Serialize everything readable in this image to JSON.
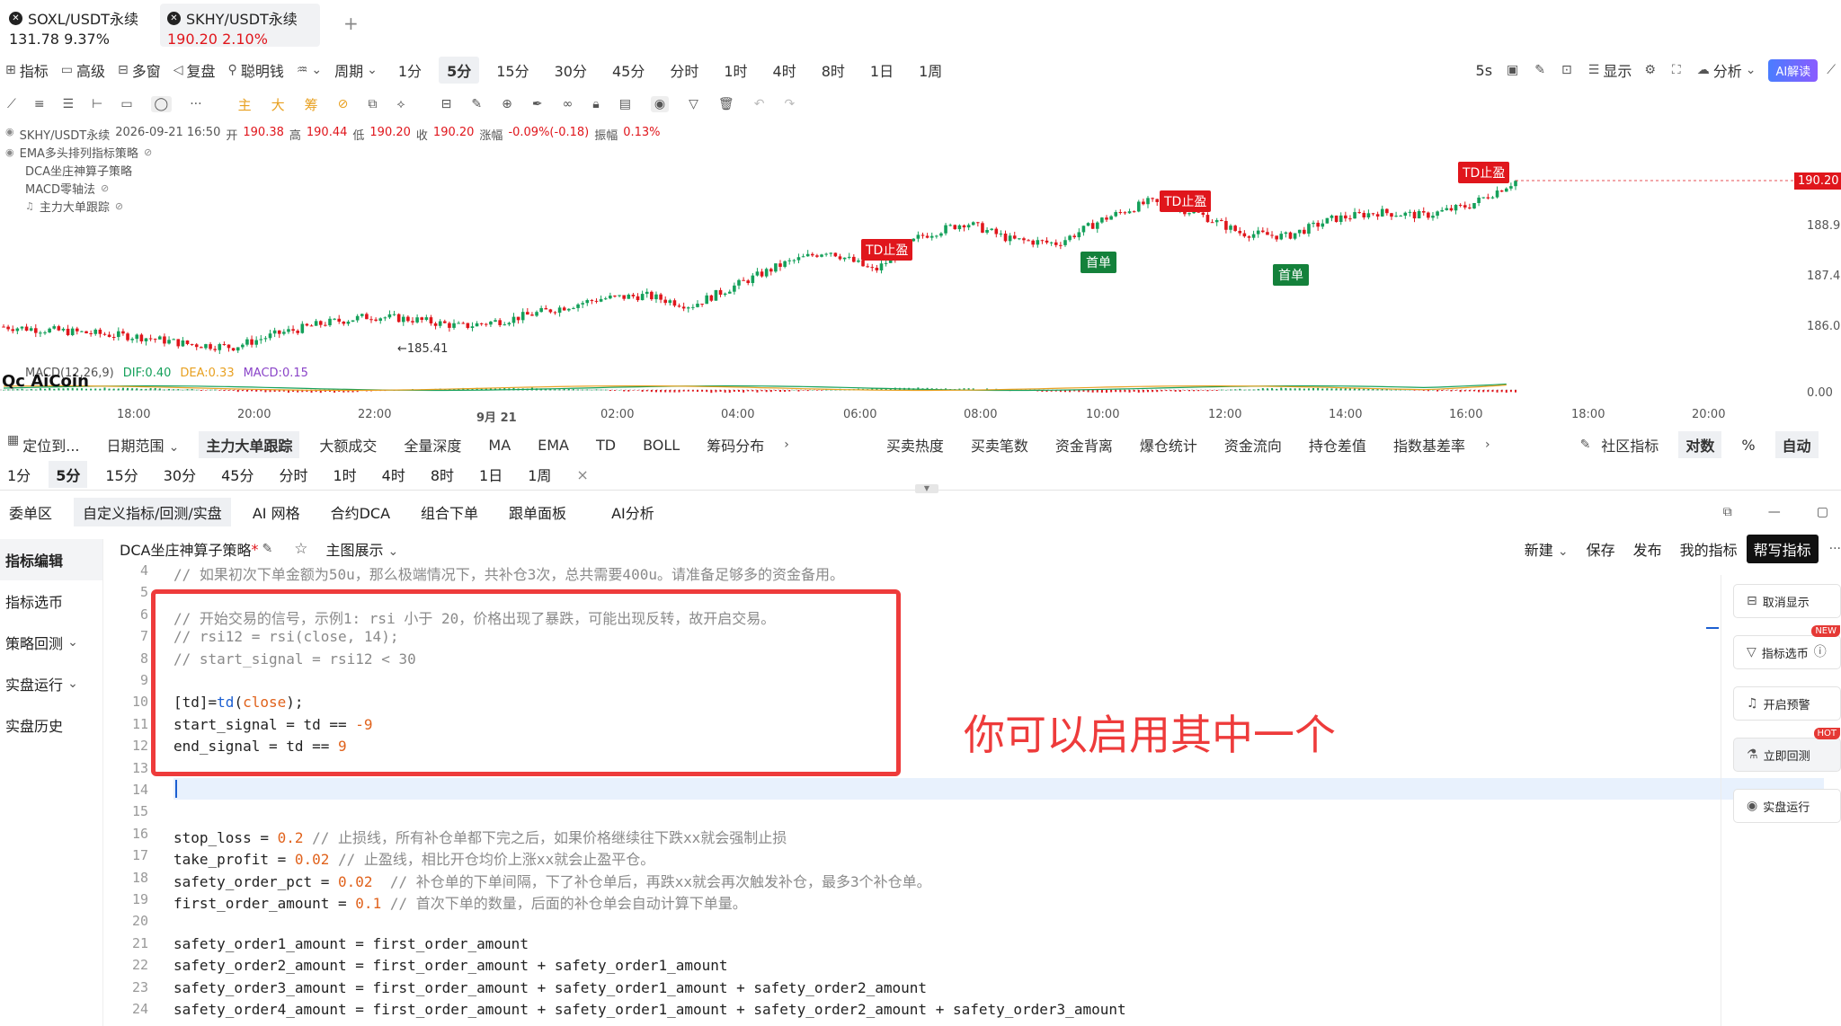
{
  "tabs": [
    {
      "name": "SOXL/USDT永续",
      "price": "131.78",
      "change": "9.37%"
    },
    {
      "name": "SKHY/USDT永续",
      "price": "190.20",
      "change": "2.10%"
    }
  ],
  "add_tab": "+",
  "toolbar": {
    "indicator": "指标",
    "advanced": "高级",
    "multi_window": "多窗",
    "replay": "复盘",
    "smart_line": "聪明钱",
    "period": "周期",
    "timeframes": [
      "1分",
      "5分",
      "15分",
      "30分",
      "45分",
      "分时",
      "1时",
      "4时",
      "8时",
      "1日",
      "1周"
    ],
    "active_tf": "5分",
    "interval": "5s",
    "display": "显示",
    "analysis": "分析",
    "ai_read": "AI解读"
  },
  "drawtools": {
    "main": "主",
    "big": "大",
    "chip": "筹"
  },
  "chart_header": {
    "symbol": "SKHY/USDT永续",
    "datetime": "2026-09-21 16:50",
    "open_label": "开",
    "open": "190.38",
    "high_label": "高",
    "high": "190.44",
    "low_label": "低",
    "low": "190.20",
    "close_label": "收",
    "close": "190.20",
    "chg_label": "涨幅",
    "chg": "-0.09%(-0.18)",
    "amp_label": "振幅",
    "amp": "0.13%"
  },
  "indicators": [
    "EMA多头排列指标策略",
    "DCA坐庄神算子策略",
    "MACD零轴法",
    "主力大单跟踪"
  ],
  "chart_labels": {
    "td_take_profit": "TD止盈",
    "first_order": "首单",
    "low_mark": "185.41"
  },
  "price_tag": "190.20",
  "macd": {
    "title": "MACD(12,26,9)",
    "dif": "DIF:0.40",
    "dea": "DEA:0.33",
    "macd": "MACD:0.15",
    "zero": "0.00"
  },
  "logo": "AiCoin",
  "chart_data": {
    "type": "candlestick",
    "y_ticks": [
      "190.20",
      "188.93",
      "187.49",
      "186.06"
    ],
    "x_ticks": [
      "18:00",
      "20:00",
      "22:00",
      "9月 21",
      "02:00",
      "04:00",
      "06:00",
      "08:00",
      "10:00",
      "12:00",
      "14:00",
      "16:00",
      "18:00",
      "20:00"
    ],
    "trend": [
      186.0,
      185.9,
      185.8,
      185.7,
      185.5,
      185.41,
      185.8,
      186.1,
      186.3,
      186.2,
      186.0,
      186.2,
      186.5,
      186.8,
      186.9,
      186.6,
      187.2,
      187.8,
      188.2,
      187.6,
      188.6,
      189.0,
      188.5,
      188.4,
      189.1,
      189.6,
      189.3,
      188.7,
      188.6,
      189.1,
      189.3,
      189.2,
      189.5,
      190.2
    ],
    "signals": [
      {
        "label": "TD止盈",
        "x": "06:50",
        "y": 188.0
      },
      {
        "label": "首单",
        "x": "09:40",
        "y": 188.5
      },
      {
        "label": "TD止盈",
        "x": "11:30",
        "y": 189.5
      },
      {
        "label": "首单",
        "x": "14:40",
        "y": 188.3
      },
      {
        "label": "TD止盈",
        "x": "16:10",
        "y": 190.2
      }
    ]
  },
  "ind_bar": {
    "locate": "定位到...",
    "date_range": "日期范围",
    "items": [
      "主力大单跟踪",
      "大额成交",
      "全量深度",
      "MA",
      "EMA",
      "TD",
      "BOLL",
      "筹码分布"
    ],
    "items2": [
      "买卖热度",
      "买卖笔数",
      "资金背离",
      "爆仓统计",
      "资金流向",
      "持仓差值",
      "指数基差率"
    ],
    "community": "社区指标",
    "log": "对数",
    "pct": "%",
    "auto": "自动"
  },
  "tf_row": [
    "1分",
    "5分",
    "15分",
    "30分",
    "45分",
    "分时",
    "1时",
    "4时",
    "8时",
    "1日",
    "1周"
  ],
  "tf_close": "×",
  "panel_tabs": [
    "委单区",
    "自定义指标/回测/实盘",
    "AI 网格",
    "合约DCA",
    "组合下单",
    "跟单面板",
    "AI分析"
  ],
  "side_menu": [
    "指标编辑",
    "指标选币",
    "策略回测",
    "实盘运行",
    "实盘历史"
  ],
  "editor": {
    "script_name": "DCA坐庄神算子策略",
    "modified": "*",
    "main_display": "主图展示",
    "new": "新建",
    "save": "保存",
    "publish": "发布",
    "my_indicators": "我的指标",
    "help_write": "帮写指标"
  },
  "code_lines": [
    {
      "n": "4",
      "t": "// 如果初次下单金额为50u，那么极端情况下，共补仓3次，总共需要400u。请准备足够多的资金备用。"
    },
    {
      "n": "5",
      "t": ""
    },
    {
      "n": "6",
      "t": "// 开始交易的信号，示例1: rsi 小于 20，价格出现了暴跌，可能出现反转，故开启交易。"
    },
    {
      "n": "7",
      "t": "// rsi12 = rsi(close, 14);"
    },
    {
      "n": "8",
      "t": "// start_signal = rsi12 < 30"
    },
    {
      "n": "9",
      "t": ""
    },
    {
      "n": "10",
      "t": "[td]=td(close);"
    },
    {
      "n": "11",
      "t": "start_signal = td == -9"
    },
    {
      "n": "12",
      "t": "end_signal = td == 9"
    },
    {
      "n": "13",
      "t": ""
    },
    {
      "n": "14",
      "t": ""
    },
    {
      "n": "15",
      "t": ""
    },
    {
      "n": "16",
      "t": "stop_loss = 0.2 // 止损线，所有补仓单都下完之后，如果价格继续往下跌xx就会强制止损"
    },
    {
      "n": "17",
      "t": "take_profit = 0.02 // 止盈线，相比开仓均价上涨xx就会止盈平仓。"
    },
    {
      "n": "18",
      "t": "safety_order_pct = 0.02  // 补仓单的下单间隔，下了补仓单后，再跌xx就会再次触发补仓，最多3个补仓单。"
    },
    {
      "n": "19",
      "t": "first_order_amount = 0.1 // 首次下单的数量，后面的补仓单会自动计算下单量。"
    },
    {
      "n": "20",
      "t": ""
    },
    {
      "n": "21",
      "t": "safety_order1_amount = first_order_amount"
    },
    {
      "n": "22",
      "t": "safety_order2_amount = first_order_amount + safety_order1_amount"
    },
    {
      "n": "23",
      "t": "safety_order3_amount = first_order_amount + safety_order1_amount + safety_order2_amount"
    },
    {
      "n": "24",
      "t": "safety_order4_amount = first_order_amount + safety_order1_amount + safety_order2_amount + safety_order3_amount"
    }
  ],
  "annotation": "你可以启用其中一个",
  "right_panel": [
    {
      "label": "取消显示",
      "badge": ""
    },
    {
      "label": "指标选币",
      "badge": "NEW"
    },
    {
      "label": "开启预警",
      "badge": ""
    },
    {
      "label": "立即回测",
      "badge": "HOT"
    },
    {
      "label": "实盘运行",
      "badge": ""
    }
  ],
  "colors": {
    "up": "#14a05a",
    "down": "#e0161c",
    "accent": "#e53935",
    "highlight_line": "#e8f1fd"
  }
}
